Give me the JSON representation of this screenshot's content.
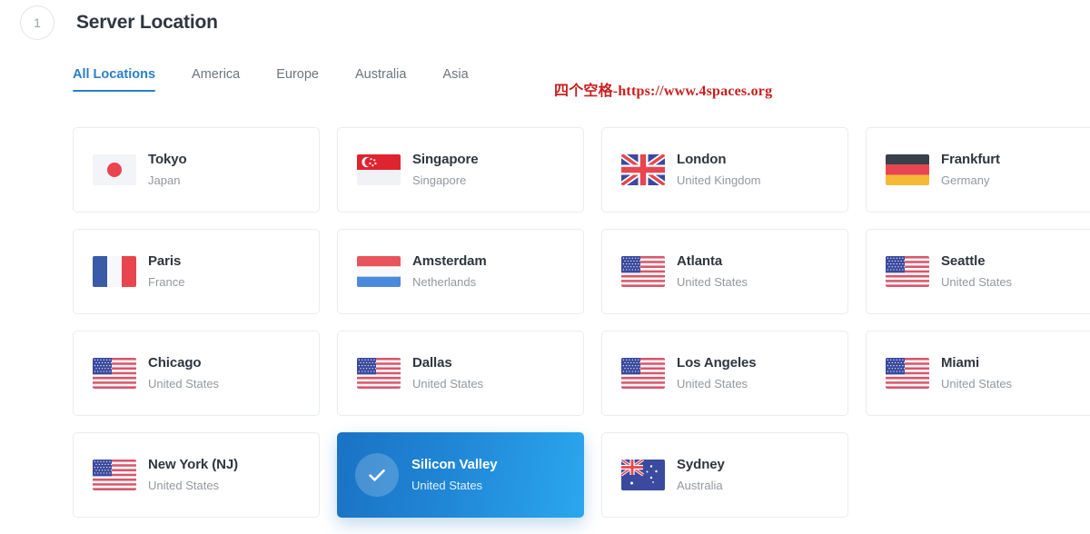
{
  "header": {
    "step_number": "1",
    "title": "Server Location"
  },
  "tabs": [
    {
      "label": "All Locations",
      "active": true
    },
    {
      "label": "America",
      "active": false
    },
    {
      "label": "Europe",
      "active": false
    },
    {
      "label": "Australia",
      "active": false
    },
    {
      "label": "Asia",
      "active": false
    }
  ],
  "watermark": {
    "text": "四个空格-https://www.4spaces.org",
    "color": "#c81f1f"
  },
  "colors": {
    "accent": "#2a7fc9",
    "selected_gradient_start": "#1a72c4",
    "selected_gradient_end": "#2ba7ee",
    "card_border": "#e9ecef",
    "city_text": "#2f3640",
    "country_text": "#9298a0"
  },
  "locations": [
    {
      "city": "Tokyo",
      "country": "Japan",
      "flag": "jp",
      "selected": false
    },
    {
      "city": "Singapore",
      "country": "Singapore",
      "flag": "sg",
      "selected": false
    },
    {
      "city": "London",
      "country": "United Kingdom",
      "flag": "gb",
      "selected": false
    },
    {
      "city": "Frankfurt",
      "country": "Germany",
      "flag": "de",
      "selected": false
    },
    {
      "city": "Paris",
      "country": "France",
      "flag": "fr",
      "selected": false
    },
    {
      "city": "Amsterdam",
      "country": "Netherlands",
      "flag": "nl",
      "selected": false
    },
    {
      "city": "Atlanta",
      "country": "United States",
      "flag": "us",
      "selected": false
    },
    {
      "city": "Seattle",
      "country": "United States",
      "flag": "us",
      "selected": false
    },
    {
      "city": "Chicago",
      "country": "United States",
      "flag": "us",
      "selected": false
    },
    {
      "city": "Dallas",
      "country": "United States",
      "flag": "us",
      "selected": false
    },
    {
      "city": "Los Angeles",
      "country": "United States",
      "flag": "us",
      "selected": false
    },
    {
      "city": "Miami",
      "country": "United States",
      "flag": "us",
      "selected": false
    },
    {
      "city": "New York (NJ)",
      "country": "United States",
      "flag": "us",
      "selected": false
    },
    {
      "city": "Silicon Valley",
      "country": "United States",
      "flag": "us",
      "selected": true
    },
    {
      "city": "Sydney",
      "country": "Australia",
      "flag": "au",
      "selected": false
    }
  ]
}
